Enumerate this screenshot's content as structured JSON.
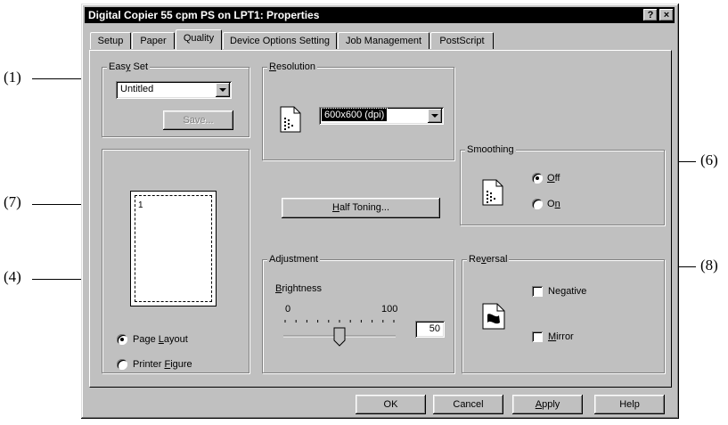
{
  "window": {
    "title": "Digital Copier 55 cpm PS on LPT1: Properties",
    "help_button": "?",
    "close_button": "×"
  },
  "tabs": [
    {
      "label": "Setup"
    },
    {
      "label": "Paper"
    },
    {
      "label": "Quality",
      "active": true
    },
    {
      "label": "Device Options Setting"
    },
    {
      "label": "Job Management"
    },
    {
      "label": "PostScript"
    }
  ],
  "easy_set": {
    "legend": "Easy Set",
    "selected": "Untitled",
    "save_label": "Save..."
  },
  "preview": {
    "page_number": "1",
    "page_layout_label": "Page Layout",
    "printer_figure_label": "Printer Figure",
    "selected": "Page Layout"
  },
  "resolution": {
    "legend": "Resolution",
    "selected": "600x600 (dpi)"
  },
  "half_toning_label": "Half Toning...",
  "smoothing": {
    "legend": "Smoothing",
    "off_label": "Off",
    "on_label": "On",
    "selected": "Off"
  },
  "adjustment": {
    "legend": "Adjustment",
    "brightness_label": "Brightness",
    "min": "0",
    "max": "100",
    "value": "50",
    "slider_fraction": 0.5
  },
  "reversal": {
    "legend": "Reversal",
    "negative_label": "Negative",
    "mirror_label": "Mirror",
    "negative_checked": false,
    "mirror_checked": false
  },
  "footer": {
    "ok": "OK",
    "cancel": "Cancel",
    "apply": "Apply",
    "help": "Help"
  },
  "callouts": {
    "c1": "(1)",
    "c7": "(7)",
    "c4": "(4)",
    "c6": "(6)",
    "c8": "(8)"
  },
  "colors": {
    "dialog_face": "#c0c0c0",
    "titlebar": "#000000",
    "selection": "#000000"
  }
}
